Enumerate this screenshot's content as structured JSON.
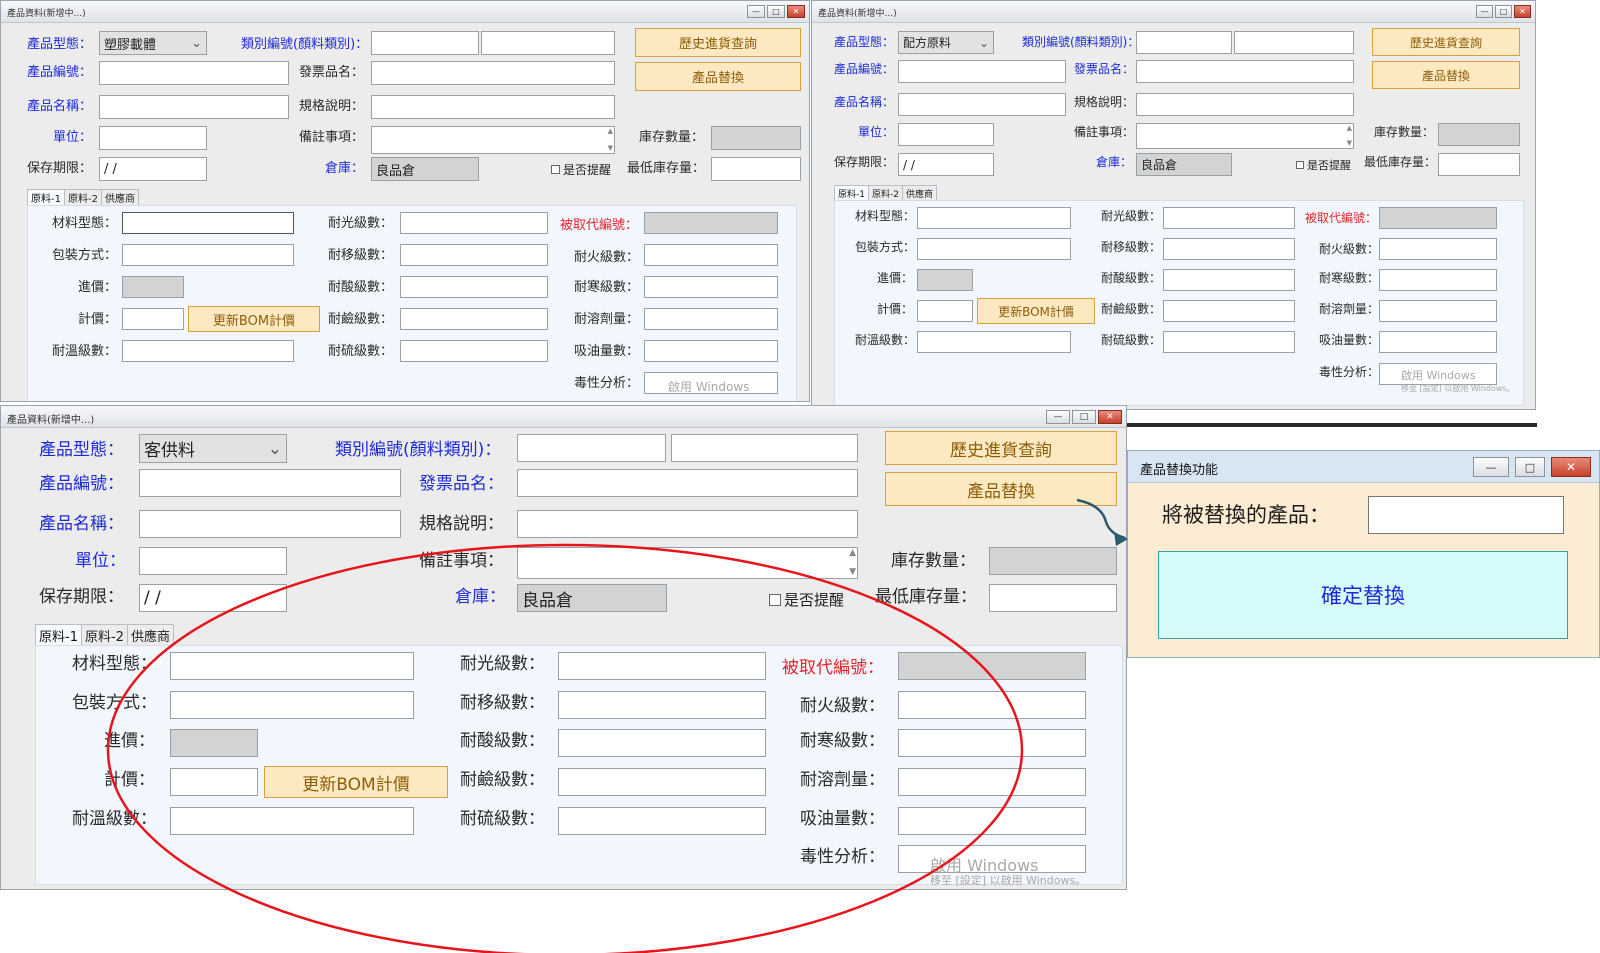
{
  "windows": [
    {
      "id": "w1",
      "title": "產品資料(新增中...)",
      "fields": {
        "product_type_label": "產品型態：",
        "product_type_value": "塑膠載體",
        "category_code_label": "類別編號(顏料類別)：",
        "history_button": "歷史進貨查詢",
        "product_code_label": "產品編號：",
        "invoice_name_label": "發票品名：",
        "replace_button": "產品替換",
        "product_name_label": "產品名稱：",
        "spec_label": "規格說明：",
        "unit_label": "單位：",
        "note_label": "備註事項：",
        "stock_qty_label": "庫存數量：",
        "shelf_life_label": "保存期限：",
        "shelf_life_value": " / /",
        "warehouse_label": "倉庫：",
        "warehouse_value": "良品倉",
        "remind_label": "是否提醒",
        "min_stock_label": "最低庫存量："
      },
      "tabs": [
        "原料-1",
        "原料-2",
        "供應商"
      ],
      "panel": {
        "material_type_label": "材料型態：",
        "packaging_label": "包裝方式：",
        "purchase_price_label": "進價：",
        "pricing_label": "計價：",
        "update_bom_button": "更新BOM計價",
        "temp_resist_label": "耐溫級數：",
        "light_resist_label": "耐光級數：",
        "migration_resist_label": "耐移級數：",
        "acid_resist_label": "耐酸級數：",
        "alkali_resist_label": "耐鹼級數：",
        "sulfur_resist_label": "耐硫級數：",
        "replaced_code_label": "被取代編號：",
        "fire_resist_label": "耐火級數：",
        "cold_resist_label": "耐寒級數：",
        "solvent_resist_label": "耐溶劑量：",
        "oil_absorb_label": "吸油量數：",
        "toxicity_label": "毒性分析：",
        "watermark_1": "啟用 Windows",
        "watermark_2": ""
      }
    },
    {
      "id": "w2",
      "title": "產品資料(新增中...)",
      "fields": {
        "product_type_label": "產品型態：",
        "product_type_value": "配方原料",
        "category_code_label": "類別編號(顏料類別)：",
        "history_button": "歷史進貨查詢",
        "product_code_label": "產品編號：",
        "invoice_name_label": "發票品名：",
        "replace_button": "產品替換",
        "product_name_label": "產品名稱：",
        "spec_label": "規格說明：",
        "unit_label": "單位：",
        "note_label": "備註事項：",
        "stock_qty_label": "庫存數量：",
        "shelf_life_label": "保存期限：",
        "shelf_life_value": " / /",
        "warehouse_label": "倉庫：",
        "warehouse_value": "良品倉",
        "remind_label": "是否提醒",
        "min_stock_label": "最低庫存量："
      },
      "tabs": [
        "原料-1",
        "原料-2",
        "供應商"
      ],
      "panel": {
        "material_type_label": "材料型態：",
        "packaging_label": "包裝方式：",
        "purchase_price_label": "進價：",
        "pricing_label": "計價：",
        "update_bom_button": "更新BOM計價",
        "temp_resist_label": "耐溫級數：",
        "light_resist_label": "耐光級數：",
        "migration_resist_label": "耐移級數：",
        "acid_resist_label": "耐酸級數：",
        "alkali_resist_label": "耐鹼級數：",
        "sulfur_resist_label": "耐硫級數：",
        "replaced_code_label": "被取代編號：",
        "fire_resist_label": "耐火級數：",
        "cold_resist_label": "耐寒級數：",
        "solvent_resist_label": "耐溶劑量：",
        "oil_absorb_label": "吸油量數：",
        "toxicity_label": "毒性分析：",
        "watermark_1": "啟用 Windows",
        "watermark_2": "移至 [設定] 以啟用 Windows。"
      }
    },
    {
      "id": "w3",
      "title": "產品資料(新增中...)",
      "fields": {
        "product_type_label": "產品型態：",
        "product_type_value": "客供料",
        "category_code_label": "類別編號(顏料類別)：",
        "history_button": "歷史進貨查詢",
        "product_code_label": "產品編號：",
        "invoice_name_label": "發票品名：",
        "replace_button": "產品替換",
        "product_name_label": "產品名稱：",
        "spec_label": "規格說明：",
        "unit_label": "單位：",
        "note_label": "備註事項：",
        "stock_qty_label": "庫存數量：",
        "shelf_life_label": "保存期限：",
        "shelf_life_value": " / /",
        "warehouse_label": "倉庫：",
        "warehouse_value": "良品倉",
        "remind_label": "是否提醒",
        "min_stock_label": "最低庫存量："
      },
      "tabs": [
        "原料-1",
        "原料-2",
        "供應商"
      ],
      "panel": {
        "material_type_label": "材料型態：",
        "packaging_label": "包裝方式：",
        "purchase_price_label": "進價：",
        "pricing_label": "計價：",
        "update_bom_button": "更新BOM計價",
        "temp_resist_label": "耐溫級數：",
        "light_resist_label": "耐光級數：",
        "migration_resist_label": "耐移級數：",
        "acid_resist_label": "耐酸級數：",
        "alkali_resist_label": "耐鹼級數：",
        "sulfur_resist_label": "耐硫級數：",
        "replaced_code_label": "被取代編號：",
        "fire_resist_label": "耐火級數：",
        "cold_resist_label": "耐寒級數：",
        "solvent_resist_label": "耐溶劑量：",
        "oil_absorb_label": "吸油量數：",
        "toxicity_label": "毒性分析：",
        "watermark_1": "啟用 Windows",
        "watermark_2": "移至 [設定] 以啟用 Windows。"
      }
    }
  ],
  "dialog": {
    "title": "產品替換功能",
    "replaced_product_label": "將被替換的產品：",
    "confirm_button": "確定替換"
  },
  "window_controls": {
    "minimize": "—",
    "maximize": "□",
    "close": "✕"
  },
  "icons": {
    "dropdown": "chevron-down-icon",
    "scroll_up": "scroll-up-icon",
    "scroll_down": "scroll-down-icon"
  },
  "colors": {
    "label_blue": "#1d2bd6",
    "label_red": "#e2262c",
    "button_orange_bg": "#fde9c1",
    "button_orange_text": "#8e5d0a",
    "annotation_red": "#e8141c",
    "arrow_teal": "#2a5b6e",
    "confirm_button_bg": "#d5fbfb"
  }
}
